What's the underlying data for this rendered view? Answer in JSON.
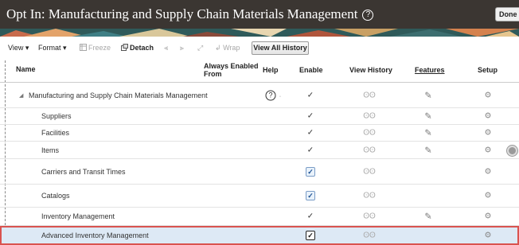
{
  "window": {
    "title": "Opt In: Manufacturing and Supply Chain Materials Management",
    "help_symbol": "?",
    "done_label": "Done"
  },
  "toolbar": {
    "view_label": "View ▾",
    "format_label": "Format ▾",
    "freeze_label": "Freeze",
    "detach_label": "Detach",
    "wrap_label": "Wrap",
    "view_all_history_label": "View All History"
  },
  "table": {
    "headers": {
      "name": "Name",
      "always_enabled_from": "Always Enabled From",
      "help": "Help",
      "enable": "Enable",
      "view_history": "View History",
      "features": "Features",
      "setup": "Setup"
    },
    "rows": [
      {
        "name": "Manufacturing and Supply Chain Materials Management",
        "help": "?",
        "enable": "✓",
        "enable_type": "check",
        "features": true
      },
      {
        "name": "Suppliers",
        "enable": "✓",
        "enable_type": "check",
        "features": true
      },
      {
        "name": "Facilities",
        "enable": "✓",
        "enable_type": "check",
        "features": true
      },
      {
        "name": "Items",
        "enable": "✓",
        "enable_type": "check",
        "features": true
      },
      {
        "name": "Carriers and Transit Times",
        "enable": "✓",
        "enable_type": "checkbox",
        "features": false
      },
      {
        "name": "Catalogs",
        "enable": "✓",
        "enable_type": "checkbox",
        "features": false
      },
      {
        "name": "Inventory Management",
        "enable": "✓",
        "enable_type": "check",
        "features": true
      },
      {
        "name": "Advanced Inventory Management",
        "enable": "✓",
        "enable_type": "checkbox-dark",
        "features": false
      }
    ]
  },
  "icons": {
    "view_history": "ʘʘ",
    "features": "✎",
    "setup": "⚙",
    "expand": "◢"
  },
  "colors": {
    "title_bar": "#3b3632",
    "selected_row": "#dde9f5",
    "selected_border": "#d9534f"
  }
}
